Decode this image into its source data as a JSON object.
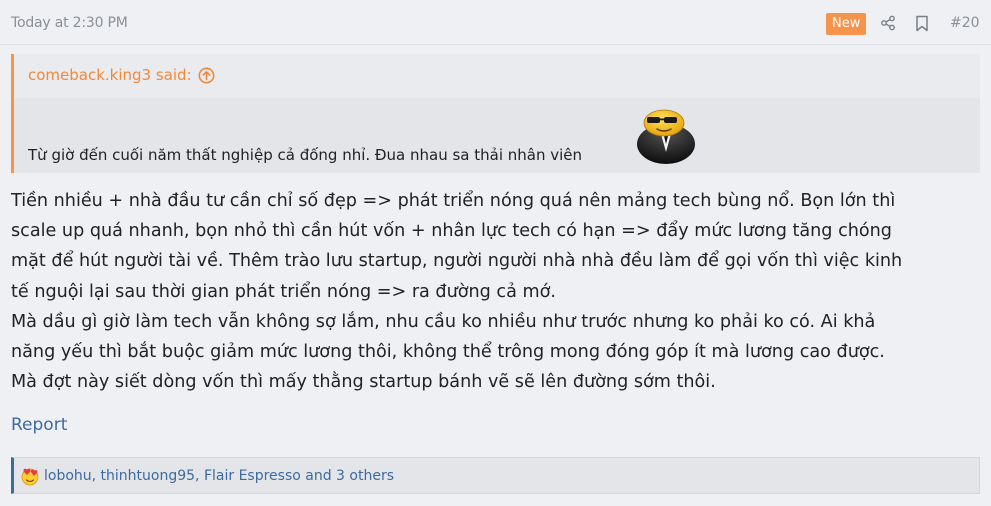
{
  "header": {
    "timestamp": "Today at 2:30 PM",
    "badge": "New",
    "post_number": "#20",
    "icons": {
      "share": "share-icon",
      "bookmark": "bookmark-icon"
    },
    "badge_color": "#f5944a"
  },
  "quote": {
    "author": "comeback.king3 said:",
    "text": "Từ giờ đến cuối năm thất nghiệp cả đống nhỉ. Đua nhau sa thải nhân viên",
    "icons": {
      "expand": "arrow-up-circle-icon",
      "smiley": "cool-smiley-icon"
    },
    "accent_color": "#f5944a"
  },
  "body": {
    "lines": [
      "Tiền nhiều + nhà đầu tư cần chỉ số đẹp => phát triển nóng quá nên mảng tech bùng nổ. Bọn lớn thì",
      "scale up quá nhanh, bọn nhỏ thì cần hút vốn + nhân lực tech có hạn => đẩy mức lương tăng chóng",
      "mặt để hút người tài về. Thêm trào lưu startup, người người nhà nhà đều làm để gọi vốn thì việc kinh",
      "tế nguội lại sau thời gian phát triển nóng => ra đường cả mớ.",
      "Mà dầu gì giờ làm tech vẫn không sợ lắm, nhu cầu ko nhiều như trước nhưng ko phải ko có. Ai khả",
      "năng yếu thì bắt buộc giảm mức lương thôi, không thể trông mong đóng góp ít mà lương cao được.",
      "Mà đợt này siết dòng vốn thì mấy thằng startup bánh vẽ sẽ lên đường sớm thôi."
    ]
  },
  "actions": {
    "report": "Report"
  },
  "reactions": {
    "icon": "love-reaction-icon",
    "users": "lobohu, thinhtuong95, Flair Espresso and 3 others",
    "link_color": "#3d6aa0"
  }
}
